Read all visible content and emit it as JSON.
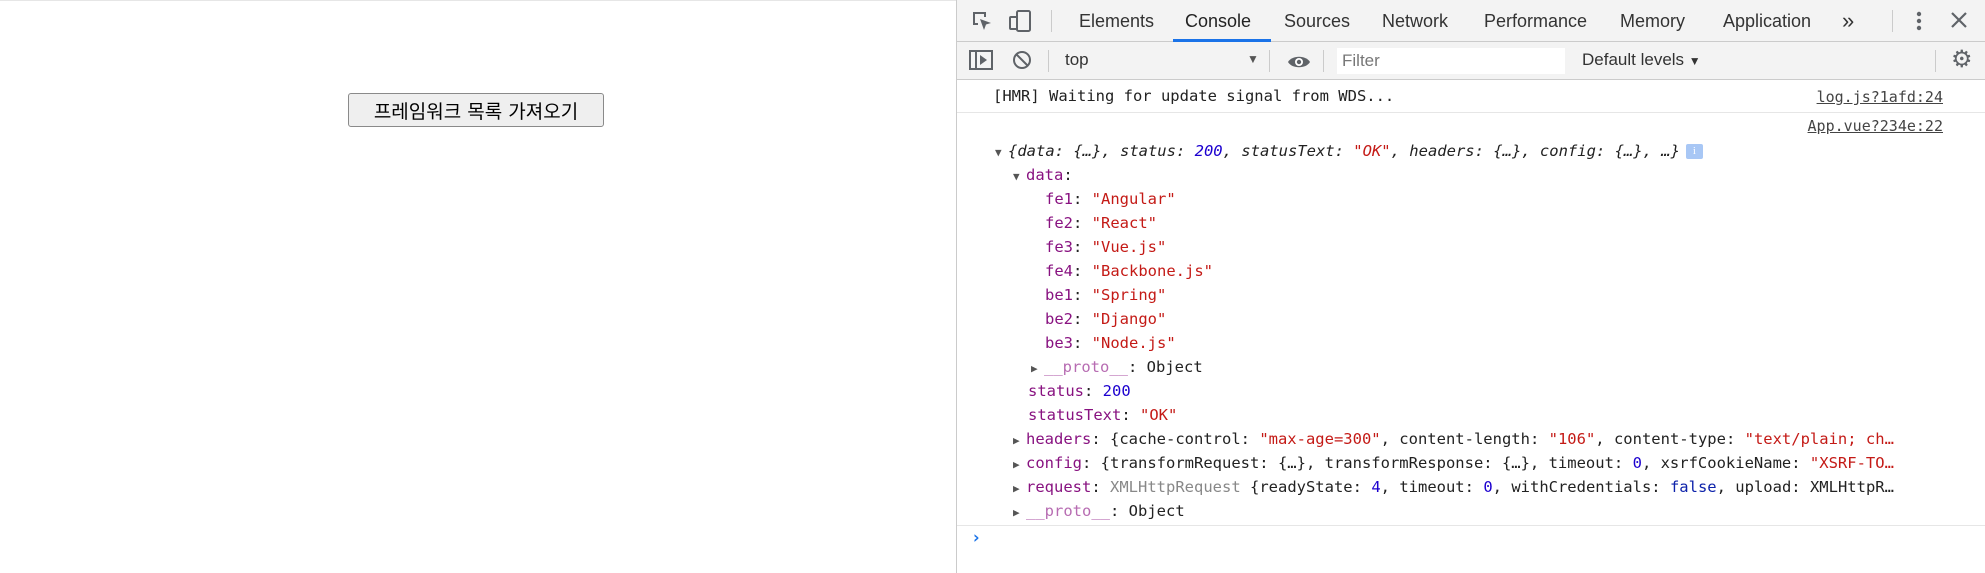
{
  "page": {
    "button_label": "프레임워크 목록 가져오기"
  },
  "devtools": {
    "tabs": [
      "Elements",
      "Console",
      "Sources",
      "Network",
      "Performance",
      "Memory",
      "Application"
    ],
    "more_tabs": "»",
    "toolbar": {
      "context": "top",
      "filter_placeholder": "Filter",
      "levels": "Default levels"
    },
    "console": {
      "hmr_message": "[HMR] Waiting for update signal from WDS...",
      "hmr_source": "log.js?1afd:24",
      "log_source": "App.vue?234e:22",
      "summary": {
        "p1": "{data: {…}, status: ",
        "status": "200",
        "p2": ", statusText: ",
        "statusText": "\"OK\"",
        "p3": ", headers: {…}, config: {…}, …}"
      },
      "data_label": "data",
      "data_entries": [
        {
          "key": "fe1",
          "value": "\"Angular\""
        },
        {
          "key": "fe2",
          "value": "\"React\""
        },
        {
          "key": "fe3",
          "value": "\"Vue.js\""
        },
        {
          "key": "fe4",
          "value": "\"Backbone.js\""
        },
        {
          "key": "be1",
          "value": "\"Spring\""
        },
        {
          "key": "be2",
          "value": "\"Django\""
        },
        {
          "key": "be3",
          "value": "\"Node.js\""
        }
      ],
      "proto_label": "__proto__",
      "proto_value": "Object",
      "status_key": "status",
      "status_value": "200",
      "status_text_key": "statusText",
      "status_text_value": "\"OK\"",
      "headers": {
        "key": "headers",
        "p1": "{cache-control: ",
        "v1": "\"max-age=300\"",
        "p2": ", content-length: ",
        "v2": "\"106\"",
        "p3": ", content-type: ",
        "v3": "\"text/plain; ch…"
      },
      "config": {
        "key": "config",
        "p1": "{transformRequest: {…}, transformResponse: {…}, timeout: ",
        "v1": "0",
        "p2": ", xsrfCookieName: ",
        "v2": "\"XSRF-TO…"
      },
      "request": {
        "key": "request",
        "type": "XMLHttpRequest",
        "p1": " {readyState: ",
        "v1": "4",
        "p2": ", timeout: ",
        "v2": "0",
        "p3": ", withCredentials: ",
        "v3": "false",
        "p4": ", upload: XMLHttpR…"
      },
      "prompt": "›"
    }
  }
}
